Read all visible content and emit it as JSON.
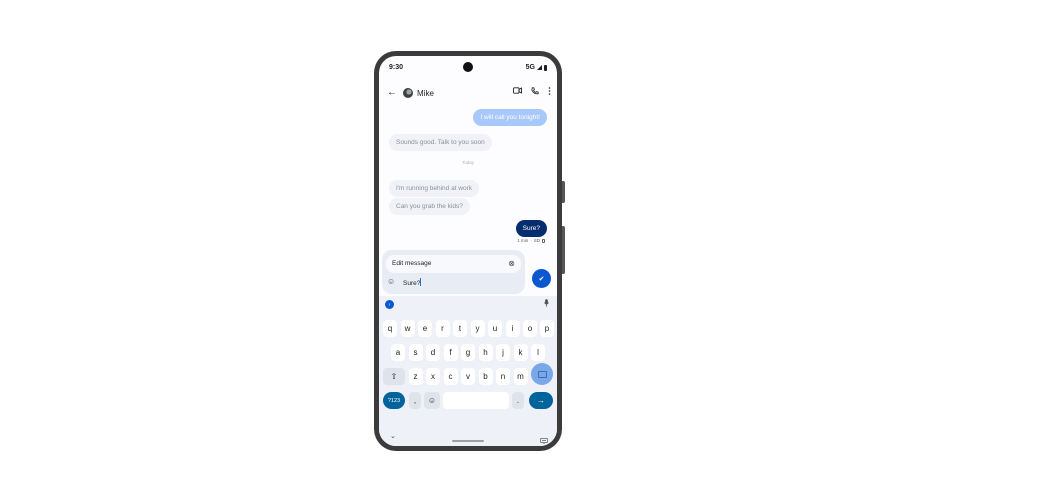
{
  "status_bar": {
    "time": "9:30",
    "network": "5G"
  },
  "app_bar": {
    "back_icon": "arrow-left-icon",
    "contact_name": "Mike",
    "actions": [
      "video-call-icon",
      "phone-icon",
      "more-vert-icon"
    ]
  },
  "messages": [
    {
      "direction": "sent",
      "text": "I will call you tonight!"
    },
    {
      "direction": "received",
      "text": "Sounds good. Talk to you soon"
    },
    {
      "direction": "divider",
      "text": "Today"
    },
    {
      "direction": "received",
      "text": "I'm running behind at work"
    },
    {
      "direction": "received",
      "text": "Can you grab the kids?"
    },
    {
      "direction": "sent",
      "text": "Sure?"
    }
  ],
  "message_meta": {
    "time": "1 min",
    "sim": "SD"
  },
  "compose": {
    "edit_label": "Edit message",
    "input_value": "Sure?"
  },
  "keyboard": {
    "row1": [
      "q",
      "w",
      "e",
      "r",
      "t",
      "y",
      "u",
      "i",
      "o",
      "p"
    ],
    "row2": [
      "a",
      "s",
      "d",
      "f",
      "g",
      "h",
      "j",
      "k",
      "l"
    ],
    "row3": [
      "z",
      "x",
      "c",
      "v",
      "b",
      "n",
      "m"
    ],
    "symbols_key": "?123",
    "comma_key": ",",
    "period_key": ".",
    "shift_symbol": "⇧",
    "enter_symbol": "→"
  },
  "colors": {
    "accent": "#0b57d0",
    "sent_dark": "#062e6f",
    "sent_faded": "#a8c7fa",
    "received": "#f0f2f8",
    "keyboard_bg": "#eef2f8"
  }
}
